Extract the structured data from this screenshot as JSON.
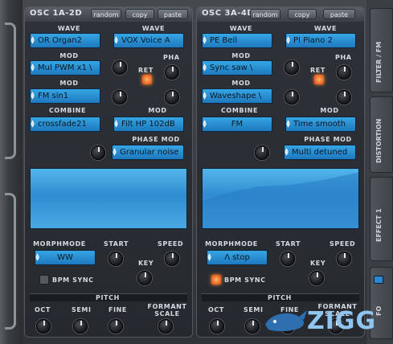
{
  "osc1": {
    "title": "OSC 1A-2D",
    "buttons": {
      "random": "random",
      "copy": "copy",
      "paste": "paste"
    },
    "wave_label": "WAVE",
    "wave1": "OR Organ2",
    "wave2": "VOX Voice A",
    "mod1_label": "MOD",
    "mod1": "Mul PWM x1 \\",
    "ret_label": "RET",
    "pha_label": "PHA",
    "mod2_label": "MOD",
    "mod2": "FM sin1",
    "combine_label": "COMBINE",
    "combine": "crossfade21",
    "mod3_label": "MOD",
    "mod3": "Filt HP 102dB",
    "phasemod_label": "PHASE MOD",
    "phasemod": "Granular noise",
    "morphmode_label": "MORPHMODE",
    "morphmode": "WW",
    "start_label": "START",
    "speed_label": "SPEED",
    "key_label": "KEY",
    "bpm_label": "BPM SYNC",
    "ret_on": true,
    "bpm_on": false
  },
  "osc2": {
    "title": "OSC 3A-4D",
    "buttons": {
      "random": "random",
      "copy": "copy",
      "paste": "paste"
    },
    "wave_label": "WAVE",
    "wave1": "PE Bell",
    "wave2": "PI Piano 2",
    "mod1_label": "MOD",
    "mod1": "Sync saw \\",
    "ret_label": "RET",
    "pha_label": "PHA",
    "mod2_label": "MOD",
    "mod2": "Waveshape \\",
    "combine_label": "COMBINE",
    "combine": "FM",
    "mod3_label": "MOD",
    "mod3": "Time smooth",
    "phasemod_label": "PHASE MOD",
    "phasemod": "Multi detuned",
    "morphmode_label": "MORPHMODE",
    "morphmode": "Λ stop",
    "start_label": "START",
    "speed_label": "SPEED",
    "key_label": "KEY",
    "bpm_label": "BPM SYNC",
    "ret_on": true,
    "bpm_on": true
  },
  "pitch": {
    "label": "PITCH",
    "oct": "OCT",
    "semi": "SEMI",
    "fine": "FINE",
    "formant": "FORMANT",
    "scale": "SCALE"
  },
  "sidebar": {
    "filter": "FILTER / FM",
    "distortion": "DISTORTION",
    "effect": "EFFECT 1",
    "lfo": "FO"
  },
  "watermark": "ZIGG",
  "colors": {
    "display": "#2b90d6",
    "led_on": "#ff7a22"
  }
}
